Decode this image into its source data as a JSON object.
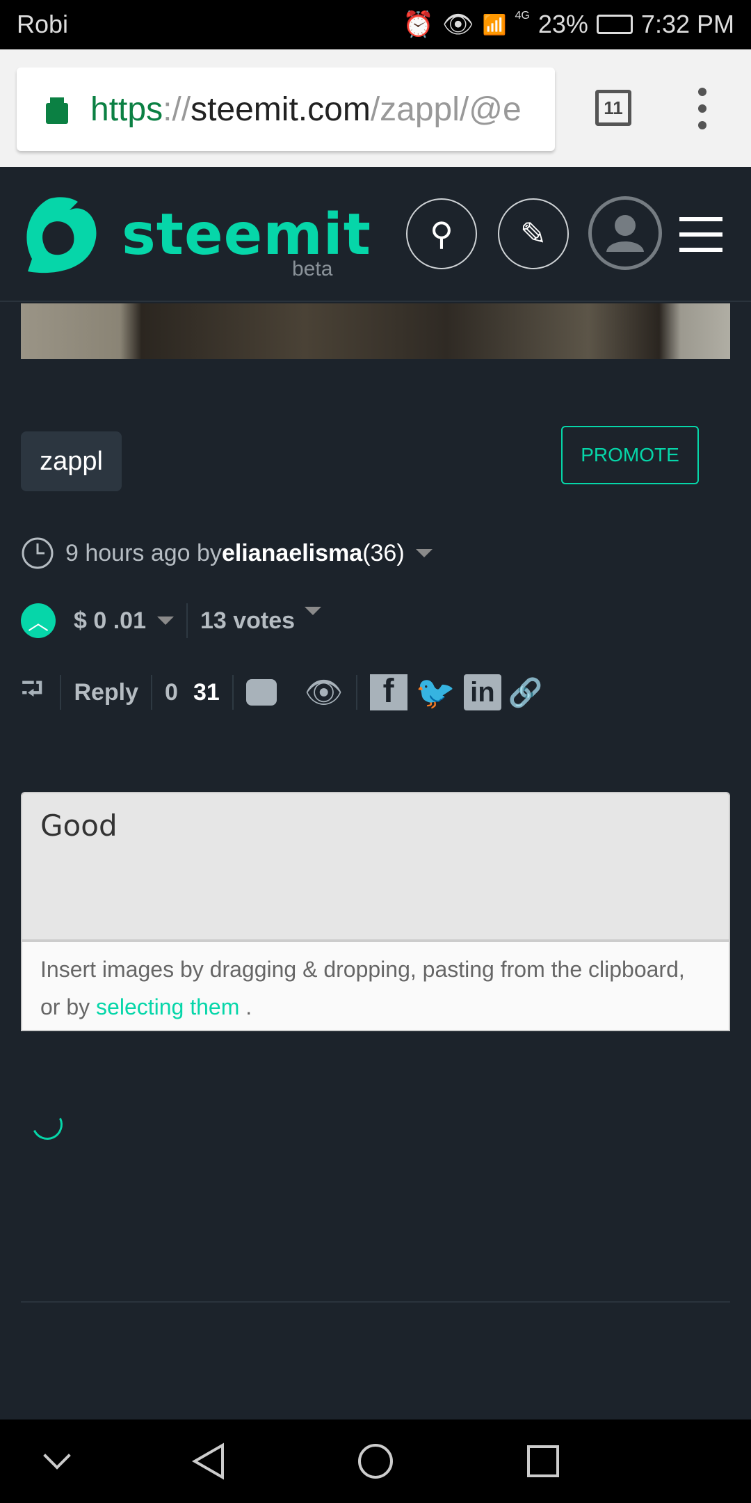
{
  "status_bar": {
    "carrier": "Robi",
    "network": "4G",
    "battery": "23%",
    "time": "7:32 PM"
  },
  "browser": {
    "url_scheme": "https",
    "url_sep": "://",
    "url_host": "steemit.com",
    "url_path": "/zappl/@e",
    "tab_count": "11"
  },
  "header": {
    "brand": "steemit",
    "badge": "beta",
    "brand_color": "#06d6a9"
  },
  "post": {
    "tag": "zappl",
    "promote_label": "PROMOTE",
    "time_ago": "9 hours ago by",
    "author": "elianaelisma",
    "reputation": "(36)",
    "payout": "$ 0 .01",
    "votes": "13 votes",
    "reply_label": "Reply",
    "count_a": "0",
    "count_b": "31"
  },
  "comment": {
    "value": "Good",
    "hint_prefix": "Insert images by dragging & dropping, pasting from the clipboard, or by ",
    "hint_link": "selecting them",
    "hint_suffix": " ."
  }
}
